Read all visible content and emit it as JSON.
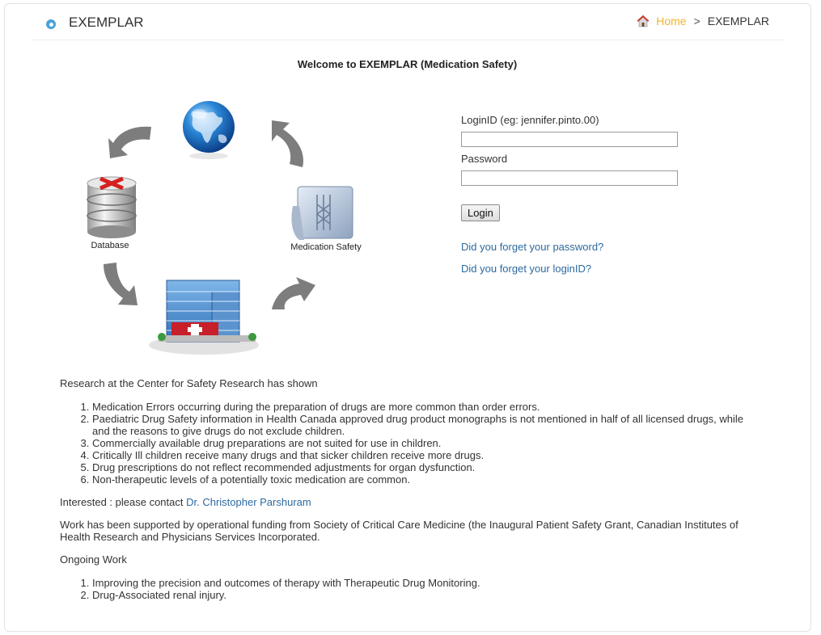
{
  "header": {
    "title": "EXEMPLAR",
    "breadcrumb": {
      "home": "Home",
      "separator": ">",
      "current": "EXEMPLAR"
    }
  },
  "welcome": "Welcome to EXEMPLAR (Medication Safety)",
  "diagram": {
    "database_label": "Database",
    "medication_label": "Medication Safety"
  },
  "login": {
    "loginid_label": "LoginID (eg: jennifer.pinto.00)",
    "loginid_value": "",
    "password_label": "Password",
    "password_value": "",
    "button": "Login",
    "forgot_password": "Did you forget your password?",
    "forgot_loginid": "Did you forget your loginID?"
  },
  "research": {
    "intro": "Research at the Center for Safety Research has shown",
    "items": [
      "Medication Errors occurring during the preparation of drugs are more common than order errors.",
      "Paediatric Drug Safety information in Health Canada approved drug product monographs is not mentioned in half of all licensed drugs, while and the reasons to give drugs do not exclude children.",
      "Commercially available drug preparations are not suited for use in children.",
      "Critically Ill children receive many drugs and that sicker children receive more drugs.",
      "Drug prescriptions do not reflect recommended adjustments for organ dysfunction.",
      "Non-therapeutic levels of a potentially toxic medication are common."
    ],
    "contact_prefix": "Interested : please contact ",
    "contact_name": "Dr. Christopher Parshuram",
    "funding": "Work has been supported by operational funding from Society of Critical Care Medicine (the Inaugural Patient Safety Grant, Canadian Institutes of Health Research and Physicians Services Incorporated.",
    "ongoing_title": "Ongoing Work",
    "ongoing_items": [
      "Improving the precision and outcomes of therapy with Therapeutic Drug Monitoring.",
      "Drug-Associated renal injury."
    ]
  },
  "colors": {
    "link": "#2d6aa0",
    "home": "#f0b42c",
    "accent_circle": "#4aa2d9"
  }
}
